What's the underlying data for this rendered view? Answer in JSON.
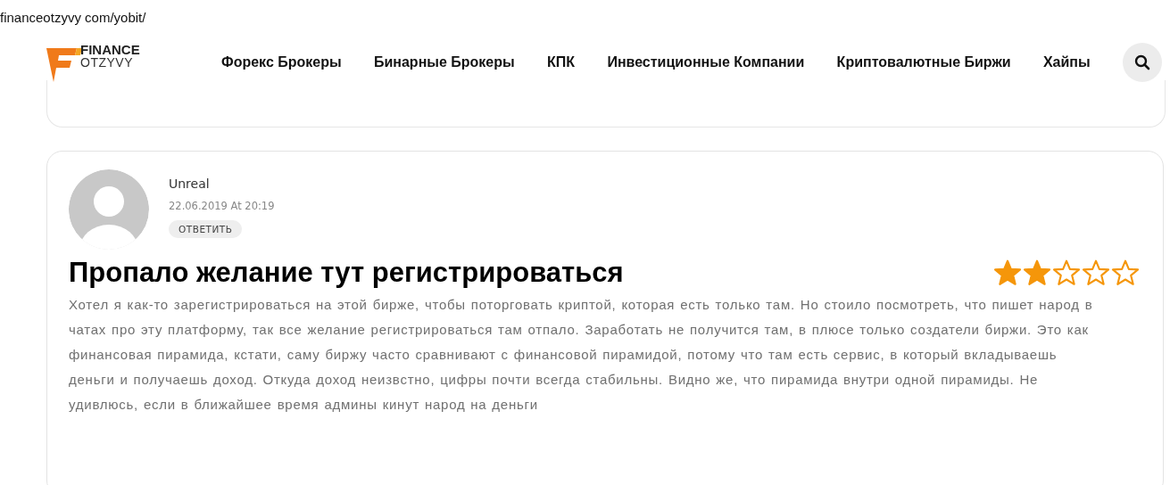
{
  "url": "financeotzyvy com/yobit/",
  "logo": {
    "line_1": "FINANCE",
    "line_2": "OTZYVY"
  },
  "nav": [
    {
      "label": "Форекс Брокеры"
    },
    {
      "label": "Бинарные Брокеры"
    },
    {
      "label": "КПК"
    },
    {
      "label": "Инвестиционные Компании"
    },
    {
      "label": "Криптовалютные Биржи"
    },
    {
      "label": "Хайпы"
    }
  ],
  "comment": {
    "author": "Unreal",
    "date": "22.06.2019 At 20:19",
    "reply_button": "ОТВЕТИТЬ",
    "title": "Пропало желание тут регистрироваться",
    "stars": 2,
    "text": "Хотел я как-то зарегистрироваться на этой бирже, чтобы поторговать криптой, которая есть только там. Но стоило посмотреть, что пишет народ в чатах про эту платформу, так все желание регистрироваться там отпало. Заработать не получится там, в плюсе только создатели биржи. Это как финансовая пирамида, кстати, саму биржу часто сравнивают с финансовой пирамидой, потому что там есть сервис, в который вкладываешь деньги и получаешь доход. Откуда доход неизвстно, цифры почти всегда стабильны. Видно же, что пирамида внутри одной пирамиды. Не удивлюсь, если в ближайшее время админы кинут народ на деньги"
  }
}
